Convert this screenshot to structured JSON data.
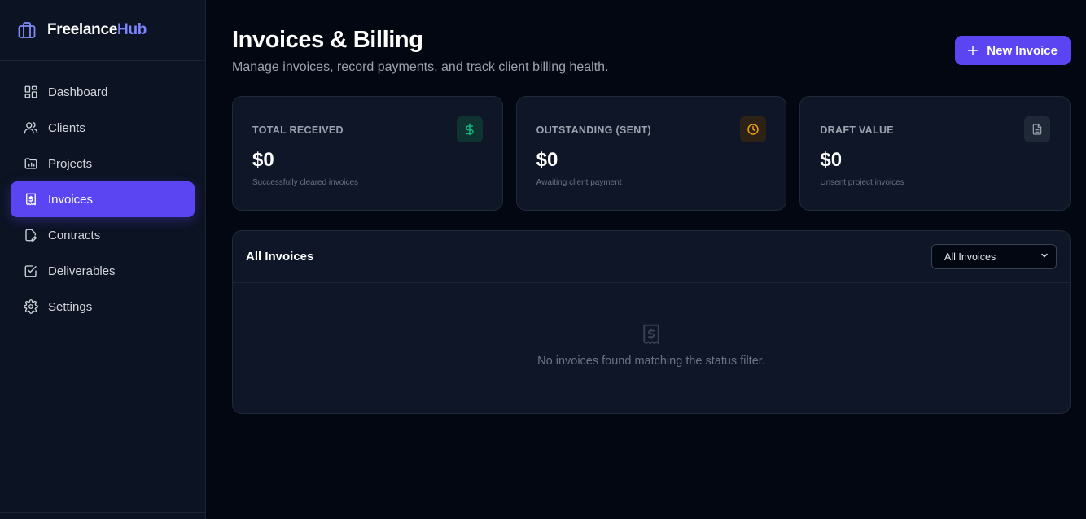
{
  "brand": {
    "name_a": "Freelance",
    "name_b": "Hub"
  },
  "nav": {
    "items": [
      {
        "label": "Dashboard",
        "icon": "dashboard-grid-icon"
      },
      {
        "label": "Clients",
        "icon": "users-icon"
      },
      {
        "label": "Projects",
        "icon": "folder-chart-icon"
      },
      {
        "label": "Invoices",
        "icon": "receipt-dollar-icon",
        "active": true
      },
      {
        "label": "Contracts",
        "icon": "file-edit-icon"
      },
      {
        "label": "Deliverables",
        "icon": "check-square-icon"
      },
      {
        "label": "Settings",
        "icon": "gear-icon"
      }
    ]
  },
  "header": {
    "title": "Invoices & Billing",
    "subtitle": "Manage invoices, record payments, and track client billing health.",
    "new_button": "New Invoice"
  },
  "stats": [
    {
      "label": "TOTAL RECEIVED",
      "value": "$0",
      "desc": "Successfully cleared invoices",
      "icon": "dollar-icon",
      "color": "#10b981"
    },
    {
      "label": "OUTSTANDING (SENT)",
      "value": "$0",
      "desc": "Awaiting client payment",
      "icon": "clock-icon",
      "color": "#f59e0b"
    },
    {
      "label": "DRAFT VALUE",
      "value": "$0",
      "desc": "Unsent project invoices",
      "icon": "document-icon",
      "color": "#9ca3af"
    }
  ],
  "invoices_panel": {
    "title": "All Invoices",
    "filter_selected": "All Invoices",
    "empty_text": "No invoices found matching the status filter."
  },
  "colors": {
    "accent": "#5b44f2",
    "brand_accent": "#7c83ff",
    "background": "#030712",
    "card": "#0f1628"
  }
}
